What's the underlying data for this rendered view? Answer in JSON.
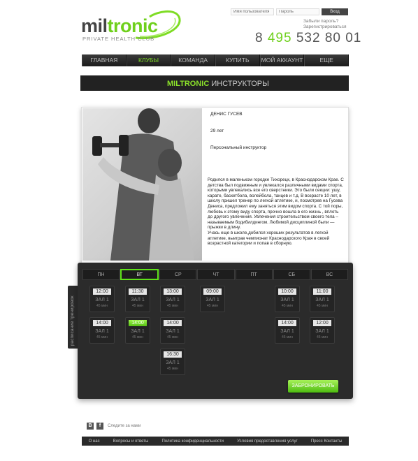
{
  "logo": {
    "name_prefix": "mil",
    "name_accent": "tronic",
    "tagline": "PRIVATE HEALTH CLUB"
  },
  "login": {
    "username_placeholder": "Имя пользователя",
    "password_placeholder": "Пароль",
    "submit_label": "Вход",
    "forgot_label": "Забыли пароль?",
    "register_label": "Зарегистрироваться"
  },
  "phone": {
    "prefix": "8",
    "code": "495",
    "number": "532 80 01"
  },
  "nav": [
    "ГЛАВНАЯ",
    "КЛУБЫ",
    "КОМАНДА",
    "КУПИТЬ",
    "МОЙ АККАУНТ",
    "ЕЩЕ"
  ],
  "nav_active_index": 1,
  "title": {
    "brand": "MILTRONIC",
    "text": "ИНСТРУКТОРЫ"
  },
  "instructor": {
    "name": "ДЕНИС ГУСЕВ",
    "age": "29 лет",
    "role": "Персональный инструктор",
    "bio": "Родился в маленьком городке Тихорецк, в Краснодарском Крае. С детства был подвижным и увлекался различными видами спорта, которыми увлекались все его сверстники. Это были секции: ушу, карате, баскетбола, волейбола, танцев и т.д.  В возрасте 10 лет, в школу пришел тренер по легкой атлетике, и, посмотрев на Гусева Дениса, предложил ему заняться этим видом спорта. С той поры, любовь к этому виду спорта, прочно вошла в его жизнь , вплоть до другого увлечения. Увлечения строительством своего тела – называемым бодибилдингом. Любимой дисциплиной были — прыжки в длину.",
    "bio2": "Учась еще в школе,добился хороших результатов в легкой атлетике, выиграв чемпионат Краснодарского Края в своей возрастной категории и попав в сборную."
  },
  "schedule": {
    "side_label": "расписание тренировок",
    "days": [
      "ПН",
      "ВТ",
      "СР",
      "ЧТ",
      "ПТ",
      "СБ",
      "ВС"
    ],
    "active_day": "ВТ",
    "hall_label": "ЗАЛ 1",
    "duration_label": "45 мин",
    "book_label": "ЗАБРОНИРОВАТЬ",
    "slots": [
      {
        "day": "ПН",
        "time": "12:00"
      },
      {
        "day": "ПН",
        "time": "14:00"
      },
      {
        "day": "ВТ",
        "time": "11:30"
      },
      {
        "day": "ВТ",
        "time": "14:00",
        "highlight": true
      },
      {
        "day": "СР",
        "time": "13:00"
      },
      {
        "day": "СР",
        "time": "14:00"
      },
      {
        "day": "СР",
        "time": "16:30"
      },
      {
        "day": "ЧТ",
        "time": "09:00"
      },
      {
        "day": "СБ",
        "time": "10:00"
      },
      {
        "day": "СБ",
        "time": "14:00"
      },
      {
        "day": "ВС",
        "time": "11:00"
      },
      {
        "day": "ВС",
        "time": "12:00"
      }
    ]
  },
  "footer": {
    "social": [
      "В",
      "f"
    ],
    "follow_label": "Следите за нами",
    "links": [
      "О нас",
      "Вопросы и ответы",
      "Политика конфиденциальности",
      "Условия предоставления услуг",
      "Пресс Контакты"
    ]
  },
  "colors": {
    "accent": "#6fd01c",
    "dark": "#2b2b2b"
  }
}
